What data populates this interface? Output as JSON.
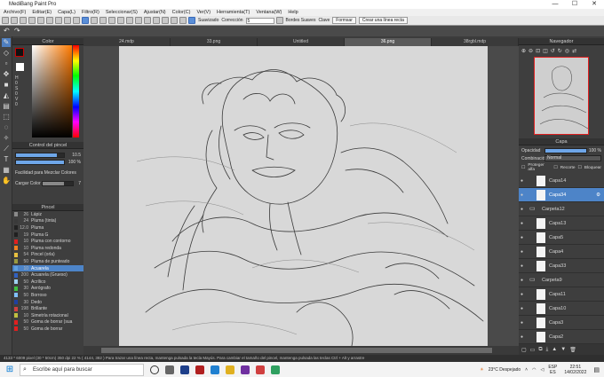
{
  "window": {
    "title": "MediBang Paint Pro",
    "controls": [
      "—",
      "☐",
      "✕"
    ]
  },
  "menu": [
    "Archivo(F)",
    "Editar(E)",
    "Capa(L)",
    "Filtro(R)",
    "Seleccionar(S)",
    "Ajustar(N)",
    "Color(C)",
    "Ver(V)",
    "Herramienta(T)",
    "Ventana(W)",
    "Help"
  ],
  "toolbar": {
    "suavizado_label": "Suavizado",
    "correccion_label": "Corrección",
    "correccion_value": "5",
    "bordes_label": "Bordes Suaves",
    "clave_label": "Clave",
    "formsar_label": "Formsar",
    "crear_linea_label": "Crear una línea recta"
  },
  "left": {
    "color_title": "Color",
    "hsv": [
      "H",
      "0",
      "S",
      "0",
      "V",
      "0"
    ],
    "brush_control_title": "Control del pincel",
    "size_value": "10.5",
    "opacity_value": "100 %",
    "mix_label": "Facilidad para Mezclar Colores",
    "load_label": "Cargar Color",
    "load_value": "7",
    "brush_title": "Pincel",
    "brushes": [
      {
        "size": "26",
        "name": "Lápiz",
        "color": "#8a8a8a"
      },
      {
        "size": "24",
        "name": "Pluma (tinta)",
        "color": "#3a3a3a"
      },
      {
        "size": "12.0",
        "name": "Pluma",
        "color": "#222222"
      },
      {
        "size": "19",
        "name": "Pluma G",
        "color": "#202020"
      },
      {
        "size": "10",
        "name": "Pluma con contorno",
        "color": "#e02020"
      },
      {
        "size": "10",
        "name": "Pluma redonda",
        "color": "#f08020"
      },
      {
        "size": "54",
        "name": "Pincel (orla)",
        "color": "#e8c040"
      },
      {
        "size": "50",
        "name": "Pluma de punteado",
        "color": "#9a9a40"
      },
      {
        "size": "10",
        "name": "Acuarela",
        "color": "#60a0e0"
      },
      {
        "size": "200",
        "name": "Acuarela (Grueso)",
        "color": "#3060c0"
      },
      {
        "size": "50",
        "name": "Acrílico",
        "color": "#a0d0f0"
      },
      {
        "size": "30",
        "name": "Aerógrafo",
        "color": "#40c040"
      },
      {
        "size": "50",
        "name": "Borroso",
        "color": "#80c0ff"
      },
      {
        "size": "30",
        "name": "Dedo",
        "color": "#2040a0"
      },
      {
        "size": "198",
        "name": "Brillante",
        "color": "#d04040"
      },
      {
        "size": "10",
        "name": "Simetría rotacional",
        "color": "#c0c040"
      },
      {
        "size": "50",
        "name": "Goma de borrar (sua",
        "color": "#e02020"
      },
      {
        "size": "50",
        "name": "Goma de borrar",
        "color": "#e02020"
      }
    ]
  },
  "tabs": [
    "24.mdp",
    "33.png",
    "Untitled",
    "36.png",
    "38rgbl.mdp"
  ],
  "right": {
    "navigator_title": "Navegador",
    "layer_title": "Capa",
    "opacity_label": "Opacidad",
    "opacity_value": "100 %",
    "blend_label": "Combinación",
    "blend_value": "Normal",
    "protect_label": "Proteger alfa",
    "clip_label": "Recorte",
    "lock_label": "Bloquear",
    "layers": [
      {
        "name": "Capa14",
        "folder": false,
        "selected": false
      },
      {
        "name": "Capa34",
        "folder": false,
        "selected": true
      },
      {
        "name": "Carpeta12",
        "folder": true,
        "selected": false
      },
      {
        "name": "Capa13",
        "folder": false,
        "selected": false
      },
      {
        "name": "Capa5",
        "folder": false,
        "selected": false
      },
      {
        "name": "Capa4",
        "folder": false,
        "selected": false
      },
      {
        "name": "Capa33",
        "folder": false,
        "selected": false
      },
      {
        "name": "Carpeta9",
        "folder": true,
        "selected": false
      },
      {
        "name": "Capa11",
        "folder": false,
        "selected": false
      },
      {
        "name": "Capa10",
        "folder": false,
        "selected": false
      },
      {
        "name": "Capa3",
        "folder": false,
        "selected": false
      },
      {
        "name": "Capa2",
        "folder": false,
        "selected": false
      }
    ]
  },
  "status": "4133 * 6009 pixel  (30 * 50cm)  350 dpi  22 %  ( 4144, 382 )  Para trazar una línea recta, mantenga pulsada la tecla Mayús. Para cambiar el tamaño del pincel, mantenga pulsada las teclas Ctrl + Alt y arrastre",
  "taskbar": {
    "search_placeholder": "Escribe aquí para buscar",
    "weather": "23°C  Despejado",
    "lang": "ESP",
    "lang2": "ES",
    "time": "22:51",
    "date": "14/02/2022"
  }
}
